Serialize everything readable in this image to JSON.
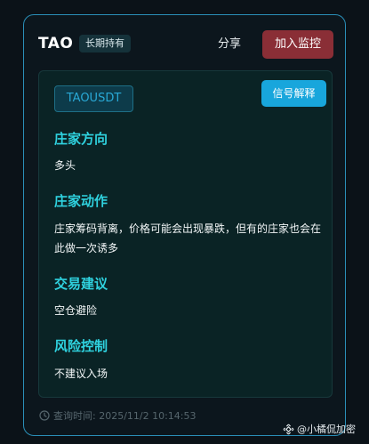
{
  "header": {
    "ticker": "TAO",
    "badge": "长期持有",
    "share_label": "分享",
    "monitor_label": "加入监控"
  },
  "panel": {
    "symbol": "TAOUSDT",
    "signal_button": "信号解释",
    "sections": [
      {
        "title": "庄家方向",
        "body": "多头"
      },
      {
        "title": "庄家动作",
        "body": "庄家筹码背离，价格可能会出现暴跌，但有的庄家也会在此做一次诱多"
      },
      {
        "title": "交易建议",
        "body": "空仓避险"
      },
      {
        "title": "风险控制",
        "body": "不建议入场"
      }
    ]
  },
  "footer": {
    "query_time": "查询时间: 2025/11/2 10:14:53"
  },
  "watermark": {
    "text": "@小橘侃加密"
  },
  "icons": {
    "clock": "clock-icon",
    "watermark_logo": "binance-logo-icon"
  },
  "colors": {
    "border_accent": "#2a8fb8",
    "section_title": "#2fd2df",
    "monitor_button": "#8a2e36",
    "signal_button": "#18a6dc"
  }
}
